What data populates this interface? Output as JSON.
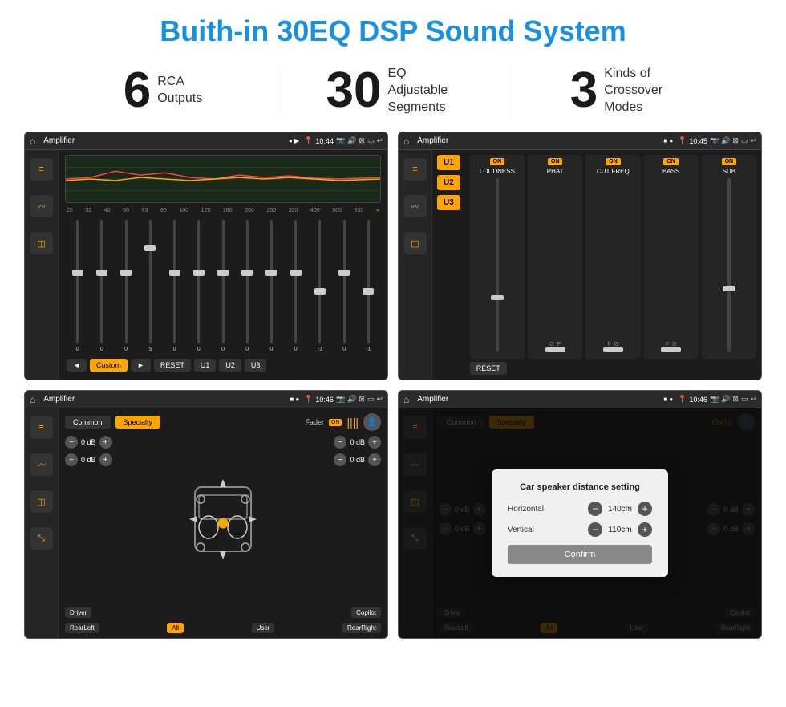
{
  "page": {
    "title": "Buith-in 30EQ DSP Sound System"
  },
  "stats": [
    {
      "number": "6",
      "label_line1": "RCA",
      "label_line2": "Outputs"
    },
    {
      "number": "30",
      "label_line1": "EQ Adjustable",
      "label_line2": "Segments"
    },
    {
      "number": "3",
      "label_line1": "Kinds of",
      "label_line2": "Crossover Modes"
    }
  ],
  "screen1": {
    "title": "Amplifier",
    "time": "10:44",
    "eq_label": "Custom",
    "freq_labels": [
      "25",
      "32",
      "40",
      "50",
      "63",
      "80",
      "100",
      "125",
      "160",
      "200",
      "250",
      "320",
      "400",
      "500",
      "630"
    ],
    "buttons": [
      "◄",
      "Custom",
      "►",
      "RESET",
      "U1",
      "U2",
      "U3"
    ],
    "slider_values": [
      "0",
      "0",
      "0",
      "5",
      "0",
      "0",
      "0",
      "0",
      "0",
      "0",
      "-1",
      "0",
      "-1"
    ]
  },
  "screen2": {
    "title": "Amplifier",
    "time": "10:45",
    "u_buttons": [
      "U1",
      "U2",
      "U3"
    ],
    "sections": [
      "LOUDNESS",
      "PHAT",
      "CUT FREQ",
      "BASS",
      "SUB"
    ],
    "on_labels": [
      "ON",
      "ON",
      "ON",
      "ON",
      "ON"
    ],
    "reset_label": "RESET"
  },
  "screen3": {
    "title": "Amplifier",
    "time": "10:46",
    "tabs": [
      "Common",
      "Specialty"
    ],
    "fader_label": "Fader",
    "fader_on": "ON",
    "db_values": [
      "0 dB",
      "0 dB",
      "0 dB",
      "0 dB"
    ],
    "bottom_buttons": [
      "Driver",
      "",
      "Copilot",
      "RearLeft",
      "All",
      "User",
      "RearRight"
    ]
  },
  "screen4": {
    "title": "Amplifier",
    "time": "10:46",
    "tabs": [
      "Common",
      "Specialty"
    ],
    "dialog": {
      "title": "Car speaker distance setting",
      "horizontal_label": "Horizontal",
      "horizontal_value": "140cm",
      "vertical_label": "Vertical",
      "vertical_value": "110cm",
      "confirm_label": "Confirm"
    },
    "bottom_buttons": [
      "Driver",
      "Copilot",
      "RearLeft",
      "All",
      "User",
      "RearRight"
    ]
  }
}
